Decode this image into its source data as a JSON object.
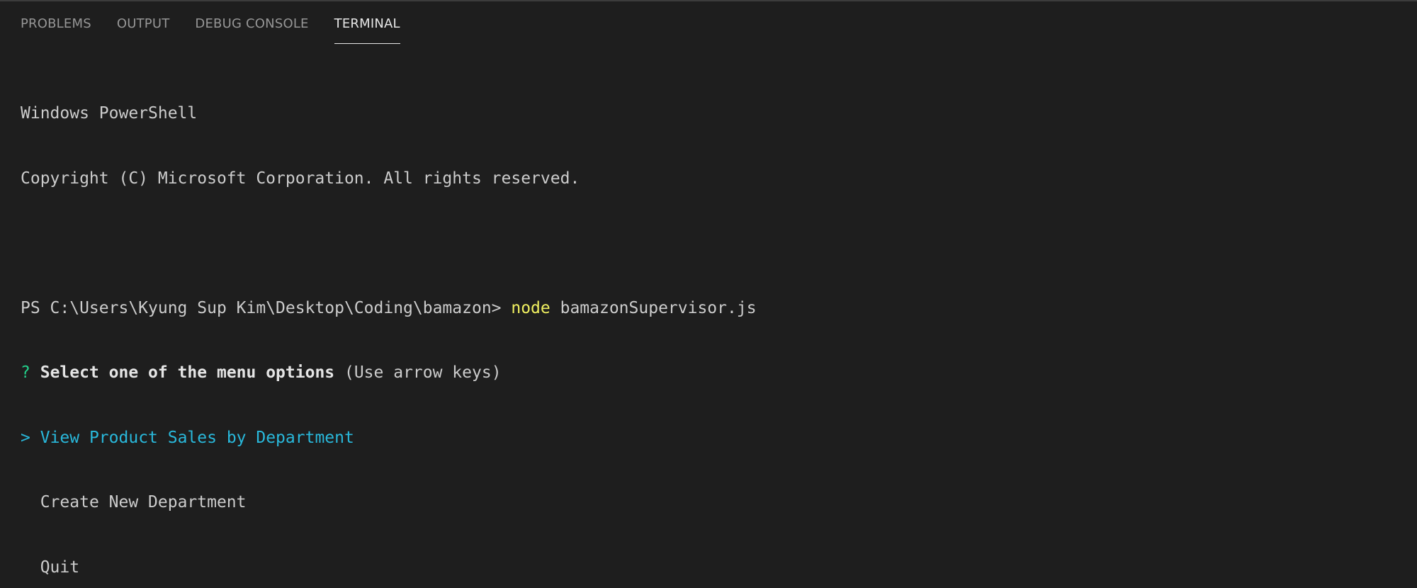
{
  "tabs": [
    {
      "label": "PROBLEMS"
    },
    {
      "label": "OUTPUT"
    },
    {
      "label": "DEBUG CONSOLE"
    },
    {
      "label": "TERMINAL"
    }
  ],
  "terminal": {
    "banner_line1": "Windows PowerShell",
    "banner_line2": "Copyright (C) Microsoft Corporation. All rights reserved.",
    "prompt": "PS C:\\Users\\Kyung Sup Kim\\Desktop\\Coding\\bamazon> ",
    "command_keyword": "node",
    "command_args": " bamazonSupervisor.js",
    "question_mark": "?",
    "question_text": "Select one of the menu options",
    "question_hint": " (Use arrow keys)",
    "menu_pointer": ">",
    "menu_items": [
      {
        "label": "View Product Sales by Department"
      },
      {
        "label": "Create New Department"
      },
      {
        "label": "Quit"
      }
    ]
  },
  "colors": {
    "background": "#1e1e1e",
    "text": "#cccccc",
    "command_keyword": "#f0f060",
    "question_mark": "#23d18b",
    "selected_item": "#29b8db"
  }
}
